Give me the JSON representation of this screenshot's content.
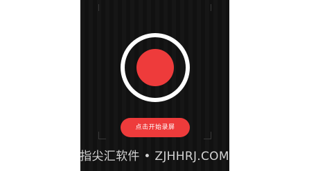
{
  "screen": {
    "start_recording_label": "点击开始录屏"
  },
  "watermark": {
    "text": "指尖汇软件 • ZJHHRJ.COM"
  },
  "icons": {
    "record": "record-icon"
  },
  "colors": {
    "background": "#111111",
    "accent": "#ee3b3b",
    "ring": "#ffffff"
  }
}
